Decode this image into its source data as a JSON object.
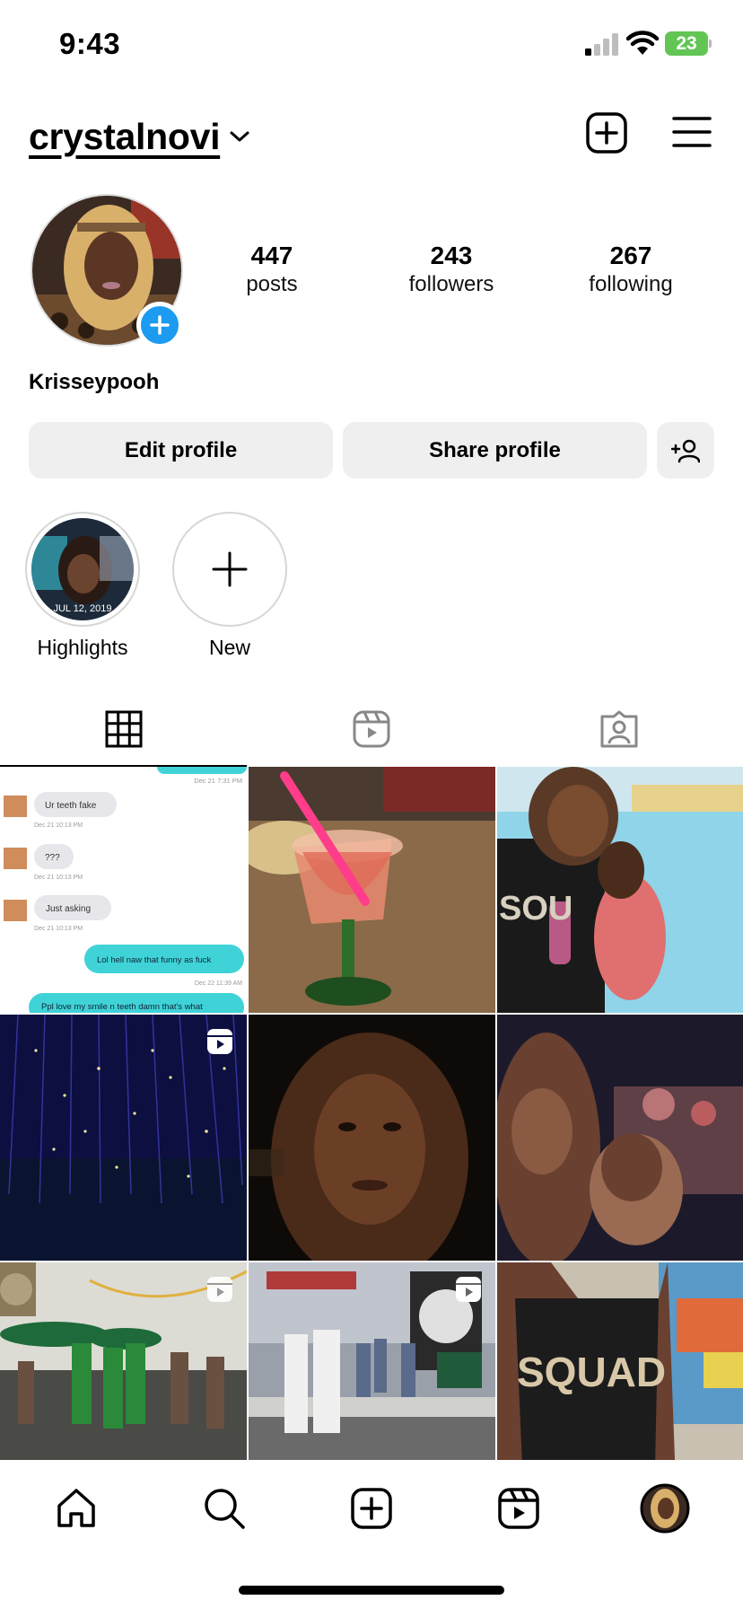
{
  "status_bar": {
    "time": "9:43",
    "battery": "23"
  },
  "header": {
    "username": "crystalnovi"
  },
  "profile": {
    "display_name": "Krisseypooh",
    "stats": [
      {
        "value": "447",
        "label": "posts"
      },
      {
        "value": "243",
        "label": "followers"
      },
      {
        "value": "267",
        "label": "following"
      }
    ],
    "buttons": {
      "edit": "Edit profile",
      "share": "Share profile"
    }
  },
  "highlights": [
    {
      "label": "Highlights",
      "image_caption": "JUL 12, 2019"
    },
    {
      "label": "New"
    }
  ],
  "tabs": [
    "posts-grid",
    "reels",
    "tagged"
  ],
  "grid_posts": [
    {
      "type": "image",
      "chat": {
        "top_time": "Dec 21 7:31 PM",
        "messages": [
          {
            "from": "them",
            "text": "Ur teeth fake",
            "time": "Dec 21 10:13 PM"
          },
          {
            "from": "them",
            "text": "???",
            "time": "Dec 21 10:13 PM"
          },
          {
            "from": "them",
            "text": "Just asking",
            "time": "Dec 21 10:13 PM"
          },
          {
            "from": "me",
            "text": "Lol hell naw that funny as fuck",
            "time": "Dec 22 11:39 AM"
          },
          {
            "from": "me",
            "text": "Ppl love my smile n teeth damn that's what"
          }
        ]
      }
    },
    {
      "type": "image"
    },
    {
      "type": "image",
      "shirt_text": "SOU"
    },
    {
      "type": "reel"
    },
    {
      "type": "image"
    },
    {
      "type": "image"
    },
    {
      "type": "reel"
    },
    {
      "type": "reel"
    },
    {
      "type": "image",
      "shirt_text": "SQUAD"
    }
  ],
  "colors": {
    "accent_blue": "#1c9bf0",
    "chat_teal": "#3fd3d8",
    "button_gray": "#efefef"
  },
  "icons": {
    "header": [
      "plus-square-icon",
      "hamburger-menu-icon"
    ],
    "nav": [
      "home-icon",
      "search-icon",
      "create-icon",
      "reels-icon",
      "profile-avatar"
    ]
  }
}
